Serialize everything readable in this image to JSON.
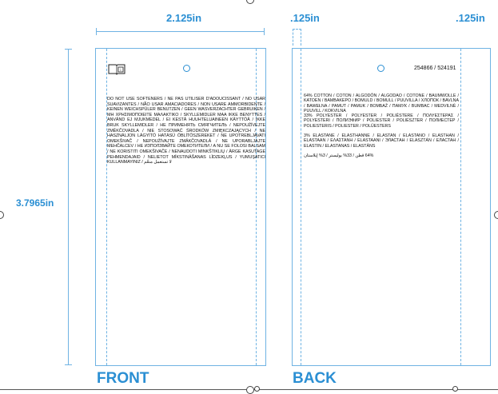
{
  "dimensions": {
    "width_label": "2.125in",
    "bleed_left_label": ".125in",
    "bleed_right_label": ".125in",
    "height_label": "3.7965in"
  },
  "front": {
    "label": "FRONT",
    "book_icon": "book-info-icon",
    "care_text": "DO NOT USE SOFTENERS / NE PAS UTILISER D'ADOUCISSANT / NO USAR SUAVIZANTES / NÃO USAR AMACIADORES / NON USARE AMMORBIDENTE / KEINEN WEICHSPÜLER BENUTZEN / GEEN WASVERZACHTER GEBRUIKEN / ΜΗ ΧΡΗΣΙΜΟΠΟΙΕΙΤΕ ΜΑΛΑΚΤΙΚΟ / SKYLLEMIDLER MAA IKKE BENYTTES / ANVÄND EJ MJUKMEDEL / EI KESTÄ HUUHTELUAINEEN KÄYTTÖÄ / IKKE BRUK SKYLLEMIDLER / НЕ ПРИМЕНЯТЬ СМЯГЧИТЕЛЬ / NEPOUŽÍVEJTE ZMĚKČOVADLA / NIE STOSOWAĆ ŚRODKÓW ZMIĘKCZAJĄCYCH / NE HASZNÁLJON LÁGYÍTÓ HATÁSÚ ÖBLÍTŐSZEREKET / NE UPOTREBLJAVATI OMEKŠIVAČ / NEPOUŽÍVAJTE ZMÄKČOVADLÁ / NE UPORABLJAJTE MEHČALCEV / НЕ ИЗПОЛЗВАЙТЕ ОМЕКОТИТЕЛИ / A NU SE FOLOSI BALSAM / NE KORISTITI OMEKŠIVAČE / NENAUDOTI MINKŠTIKLIŲ / ÄRGE KASUTAGE PEHMENDAJAID / NELIETOT MĪKSTINĀŠANAS LĪDZEKĻUS / YUMUŞATICI KULLANMAYINIZ / لا تستعمل منعّم"
  },
  "back": {
    "label": "BACK",
    "code": "254866 / 524191",
    "composition": [
      "64% COTTON / COTON / ALGODÓN / ALGODAO / COTONE / BAUMWOLLE / KATOEN / ΒΑΜΒΑΚΕΡΟ / BOMULD / BOMULL / PUUVILLA / ХЛОПОК / BAVLNA / BAWEŁNA / PAMUT / PAMUK / ВОМБАŽ / ПАМУК / BUMBAC / MEDVILNĖ / PUUVILL / KOKVILNA",
      "33% POLYESTER / POLYESTER / POLIÉSTERE / ΠΟΛΥΕΣΤΕΡΑΣ / POLYESTERI / ПОЛИЭФИР / POLIESTER / POLIÉSZTER / ПОЛИЕСТЕР / POLIESTERIS / POLIESTER / POLÜESTERS",
      "3% ELASTANE / ELASTHANNE / ELASTAN / ELASTANO / ELASTHAN / ELASTAAN / ΕΛΑΣΤΑΝΗ / ELASTAANI / ЭЛАСТАН / ELASZTÁN / ЕЛАСТАН / ELASTIN / ELASTANAS / ELASTĀNS",
      "64% قطن / 33% بوليستر / 3% إيلاستان"
    ]
  }
}
